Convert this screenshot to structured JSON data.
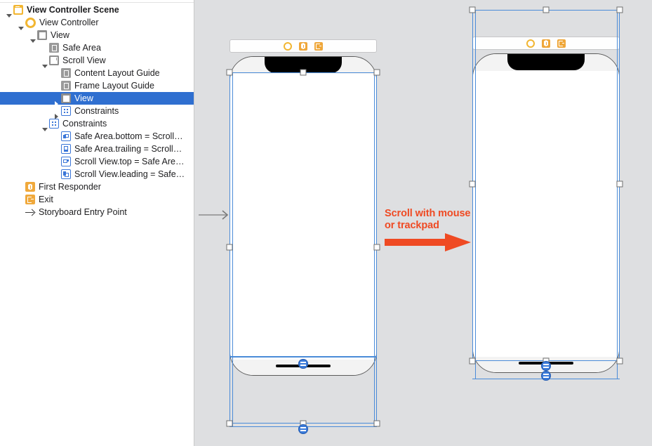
{
  "outline": {
    "name": "document-outline",
    "items": [
      {
        "label": "View Controller Scene",
        "icon": "scene-icon",
        "indent": 0,
        "twisty": "down",
        "bold": true,
        "selected": false
      },
      {
        "label": "View Controller",
        "icon": "view-controller-icon",
        "indent": 1,
        "twisty": "down",
        "bold": false,
        "selected": false
      },
      {
        "label": "View",
        "icon": "view-icon",
        "indent": 2,
        "twisty": "down",
        "bold": false,
        "selected": false
      },
      {
        "label": "Safe Area",
        "icon": "layout-guide-icon",
        "indent": 3,
        "twisty": "none",
        "bold": false,
        "selected": false
      },
      {
        "label": "Scroll View",
        "icon": "scroll-view-icon",
        "indent": 3,
        "twisty": "down",
        "bold": false,
        "selected": false
      },
      {
        "label": "Content Layout Guide",
        "icon": "layout-guide-icon",
        "indent": 4,
        "twisty": "none",
        "bold": false,
        "selected": false
      },
      {
        "label": "Frame Layout Guide",
        "icon": "layout-guide-icon",
        "indent": 4,
        "twisty": "none",
        "bold": false,
        "selected": false
      },
      {
        "label": "View",
        "icon": "view-icon",
        "indent": 4,
        "twisty": "right",
        "bold": false,
        "selected": true
      },
      {
        "label": "Constraints",
        "icon": "constraints-group-icon",
        "indent": 4,
        "twisty": "right",
        "bold": false,
        "selected": false
      },
      {
        "label": "Constraints",
        "icon": "constraints-group-icon",
        "indent": 3,
        "twisty": "down",
        "bold": false,
        "selected": false
      },
      {
        "label": "Safe Area.bottom = Scroll…",
        "icon": "constraint-bottom-icon",
        "indent": 4,
        "twisty": "none",
        "bold": false,
        "selected": false
      },
      {
        "label": "Safe Area.trailing = Scroll…",
        "icon": "constraint-trailing-icon",
        "indent": 4,
        "twisty": "none",
        "bold": false,
        "selected": false
      },
      {
        "label": "Scroll View.top = Safe Are…",
        "icon": "constraint-top-icon",
        "indent": 4,
        "twisty": "none",
        "bold": false,
        "selected": false
      },
      {
        "label": "Scroll View.leading = Safe…",
        "icon": "constraint-leading-icon",
        "indent": 4,
        "twisty": "none",
        "bold": false,
        "selected": false
      },
      {
        "label": "First Responder",
        "icon": "first-responder-icon",
        "indent": 1,
        "twisty": "none",
        "bold": false,
        "selected": false
      },
      {
        "label": "Exit",
        "icon": "exit-icon",
        "indent": 1,
        "twisty": "none",
        "bold": false,
        "selected": false
      },
      {
        "label": "Storyboard Entry Point",
        "icon": "entry-point-arrow-icon",
        "indent": 1,
        "twisty": "none",
        "bold": false,
        "selected": false
      }
    ]
  },
  "canvas": {
    "name": "interface-builder-canvas",
    "background_color": "#dedfe1",
    "scenes": [
      {
        "name": "scene-before-scroll",
        "dock_icons": [
          "view-controller-icon",
          "first-responder-icon",
          "exit-icon"
        ]
      },
      {
        "name": "scene-after-scroll",
        "dock_icons": [
          "view-controller-icon",
          "first-responder-icon",
          "exit-icon"
        ]
      }
    ],
    "selection_color": "#4a8bd8"
  },
  "annotation": {
    "name": "scroll-annotation",
    "line1": "Scroll with mouse",
    "line2": "or trackpad",
    "color": "#ef4a23",
    "arrow": "right-arrow-icon"
  }
}
